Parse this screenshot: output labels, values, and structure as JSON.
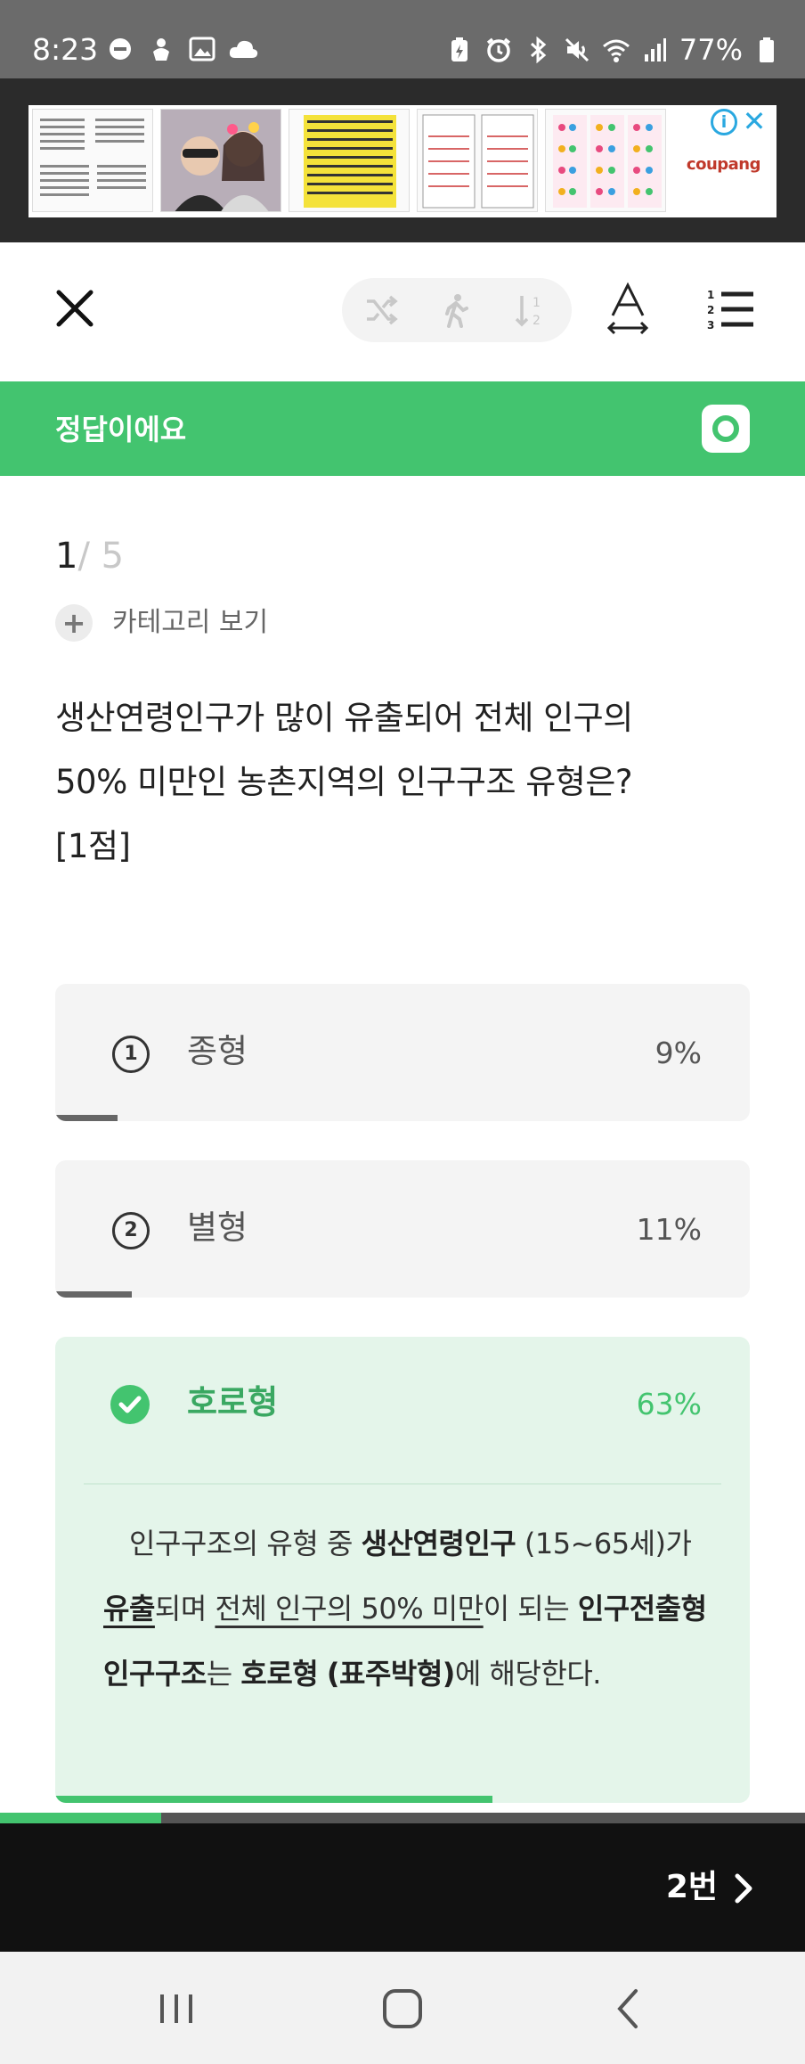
{
  "status_bar": {
    "time": "8:23",
    "battery": "77%",
    "left_icons": [
      "minus-circle-icon",
      "hand-icon",
      "image-icon",
      "cloud-icon"
    ],
    "right_icons": [
      "battery-saver-icon",
      "alarm-icon",
      "bluetooth-icon",
      "mute-icon",
      "wifi-icon",
      "signal-icon",
      "battery-icon"
    ]
  },
  "ad": {
    "brand": "coupang",
    "info_glyph": "i",
    "close_glyph": "✕"
  },
  "toolbar": {
    "close_icon": "close-icon",
    "shuffle_icon": "shuffle-icon",
    "walk_icon": "walk-icon",
    "sort_icon": "sort-numeric-icon",
    "font_icon": "font-size-icon",
    "list_icon": "numbered-list-icon"
  },
  "result": {
    "label": "정답이에요",
    "mark_icon": "circle-correct-icon",
    "color": "#43c46f"
  },
  "progress": {
    "current": "1",
    "total": "/ 5"
  },
  "category": {
    "plus": "+",
    "label": "카테고리 보기"
  },
  "question": {
    "line1": "생산연령인구가 많이 유출되어 전체 인구의",
    "line2": "50% 미만인 농촌지역의 인구구조 유형은?",
    "line3": "[1점]"
  },
  "options": [
    {
      "num": "1",
      "label": "종형",
      "percent": "9%",
      "fill": 0.09
    },
    {
      "num": "2",
      "label": "별형",
      "percent": "11%",
      "fill": 0.11
    }
  ],
  "answer": {
    "label": "호로형",
    "percent": "63%",
    "fill": 0.63,
    "explanation": {
      "p1": "인구구조의 유형 중 ",
      "b1": "생산연령인구",
      "p2": "(15~65세)가 ",
      "u1": "유출",
      "p3": "되며 ",
      "u2": "전체 인구의 50% 미만",
      "p4": "이 되는 ",
      "b2": "인구전출형 인구구조",
      "p5": "는 ",
      "b3": "호로형",
      "b4": "(표주박형)",
      "p6": "에 해당한다."
    }
  },
  "quiz_progress": 0.2,
  "next": {
    "label": "2번",
    "icon": "chevron-right-icon"
  },
  "nav": {
    "recent_icon": "recent-apps-icon",
    "home_icon": "home-icon",
    "back_icon": "back-icon"
  }
}
